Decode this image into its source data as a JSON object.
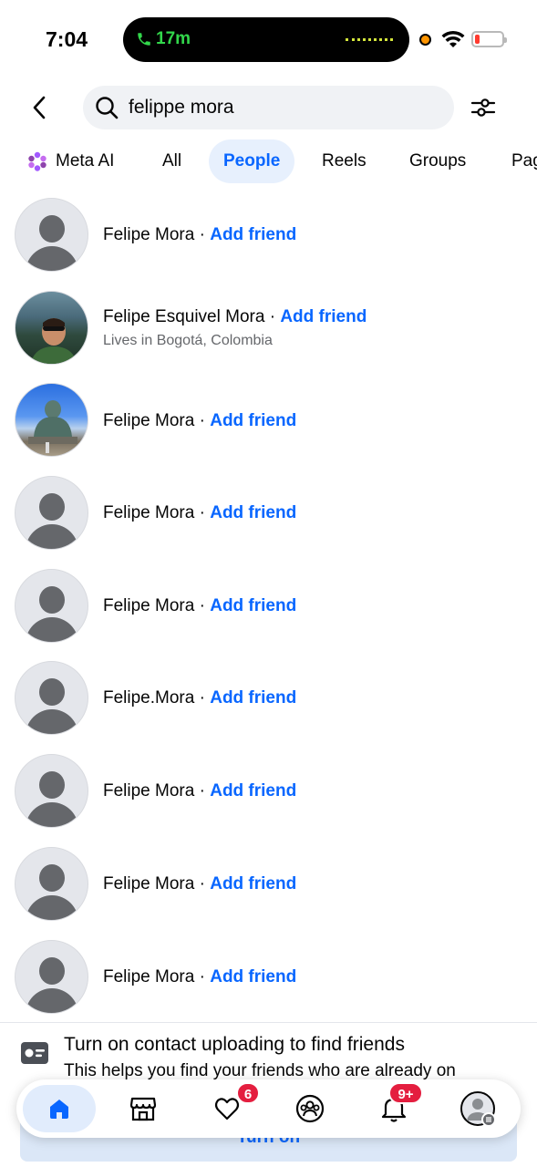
{
  "status_bar": {
    "time": "7:04",
    "call_timer": "17m"
  },
  "search": {
    "query": "felippe mora",
    "placeholder": "Search"
  },
  "tabs": [
    {
      "label": "Meta AI",
      "icon": "meta-ai-icon"
    },
    {
      "label": "All"
    },
    {
      "label": "People",
      "active": true
    },
    {
      "label": "Reels"
    },
    {
      "label": "Groups"
    },
    {
      "label": "Pag"
    }
  ],
  "people": [
    {
      "name": "Felipe Mora",
      "separator": " · ",
      "action": "Add friend",
      "avatar": "default"
    },
    {
      "name": "Felipe Esquivel Mora",
      "separator": " · ",
      "action": "Add friend",
      "subtitle": "Lives in Bogotá, Colombia",
      "avatar": "photo"
    },
    {
      "name": "Felipe Mora",
      "separator": " · ",
      "action": "Add friend",
      "avatar": "photo"
    },
    {
      "name": "Felipe Mora",
      "separator": " · ",
      "action": "Add friend",
      "avatar": "default"
    },
    {
      "name": "Felipe Mora",
      "separator": " · ",
      "action": "Add friend",
      "avatar": "default"
    },
    {
      "name": "Felipe.Mora",
      "separator": " · ",
      "action": "Add friend",
      "avatar": "default"
    },
    {
      "name": "Felipe Mora",
      "separator": " · ",
      "action": "Add friend",
      "avatar": "default"
    },
    {
      "name": "Felipe Mora",
      "separator": " · ",
      "action": "Add friend",
      "avatar": "default"
    },
    {
      "name": "Felipe Mora",
      "separator": " · ",
      "action": "Add friend",
      "avatar": "default"
    }
  ],
  "contact_upload": {
    "title": "Turn on contact uploading to find friends",
    "description": "This helps you find your friends who are already on",
    "button": "Turn on"
  },
  "bottom_nav": {
    "items": [
      {
        "icon": "home-icon",
        "active": true
      },
      {
        "icon": "marketplace-icon"
      },
      {
        "icon": "dating-icon",
        "badge": "6"
      },
      {
        "icon": "groups-icon"
      },
      {
        "icon": "bell-icon",
        "badge": "9+"
      },
      {
        "icon": "profile-icon"
      }
    ]
  },
  "colors": {
    "accent": "#0866ff",
    "badge": "#e41e3f",
    "tab_active_bg": "#e7f0fd"
  }
}
